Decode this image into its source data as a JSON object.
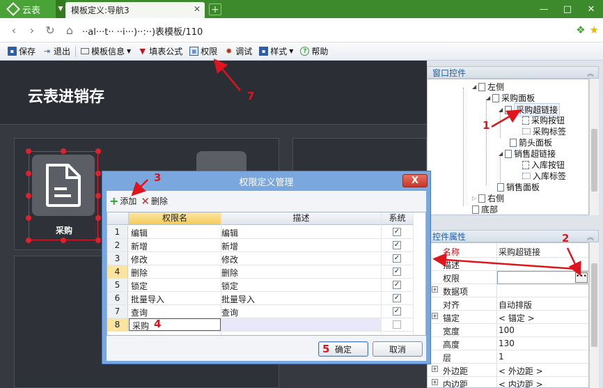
{
  "browser": {
    "brand": "云表",
    "tab_title": "模板定义:导航3",
    "url": "··al···t·· ··i···)··:··)表模板/110"
  },
  "toolbar": {
    "save": "保存",
    "exit": "退出",
    "template_info": "模板信息",
    "fill_formula": "填表公式",
    "permission": "权限",
    "debug": "调试",
    "style": "样式",
    "help": "帮助"
  },
  "canvas": {
    "app_title": "云表进销存",
    "tile_label": "采购"
  },
  "window_controls": {
    "header": "窗口控件",
    "tree": [
      {
        "label": "左侧",
        "icon": "panel"
      },
      {
        "label": "采购面板",
        "icon": "panel"
      },
      {
        "label": "采购超链接",
        "icon": "link"
      },
      {
        "label": "采购按钮",
        "icon": "button"
      },
      {
        "label": "采购标签",
        "icon": "label"
      },
      {
        "label": "箭头面板",
        "icon": "panel"
      },
      {
        "label": "销售超链接",
        "icon": "link"
      },
      {
        "label": "入库按钮",
        "icon": "button"
      },
      {
        "label": "入库标签",
        "icon": "label"
      },
      {
        "label": "销售面板",
        "icon": "panel"
      },
      {
        "label": "右侧",
        "icon": "panel"
      },
      {
        "label": "底部",
        "icon": "panel"
      }
    ]
  },
  "control_props": {
    "header": "控件属性",
    "rows": [
      {
        "key": "名称",
        "value": "采购超链接"
      },
      {
        "key": "描述",
        "value": ""
      },
      {
        "key": "权限",
        "value": ""
      },
      {
        "key": "数据项",
        "value": ""
      },
      {
        "key": "对齐",
        "value": "自动排版"
      },
      {
        "key": "锚定",
        "value": "< 锚定 >"
      },
      {
        "key": "宽度",
        "value": "100"
      },
      {
        "key": "高度",
        "value": "130"
      },
      {
        "key": "层",
        "value": "1"
      },
      {
        "key": "外边距",
        "value": "< 外边距 >"
      },
      {
        "key": "内边距",
        "value": "< 内边距 >"
      }
    ]
  },
  "dialog": {
    "title": "权限定义管理",
    "close": "X",
    "add": "添加",
    "delete": "删除",
    "columns": {
      "name": "权限名",
      "desc": "描述",
      "system": "系统"
    },
    "rows": [
      {
        "n": "1",
        "name": "编辑",
        "desc": "编辑",
        "system": true
      },
      {
        "n": "2",
        "name": "新增",
        "desc": "新增",
        "system": true
      },
      {
        "n": "3",
        "name": "修改",
        "desc": "修改",
        "system": true
      },
      {
        "n": "4",
        "name": "删除",
        "desc": "删除",
        "system": true
      },
      {
        "n": "5",
        "name": "锁定",
        "desc": "锁定",
        "system": true
      },
      {
        "n": "6",
        "name": "批量导入",
        "desc": "批量导入",
        "system": true
      },
      {
        "n": "7",
        "name": "查询",
        "desc": "查询",
        "system": true
      },
      {
        "n": "8",
        "name": "采购",
        "desc": "",
        "system": false
      }
    ],
    "ok": "确定",
    "cancel": "取消"
  },
  "annotations": {
    "a1": "1",
    "a2": "2",
    "a3": "3",
    "a4": "4",
    "a5": "5",
    "a7": "7",
    "color": "#e0141c"
  }
}
